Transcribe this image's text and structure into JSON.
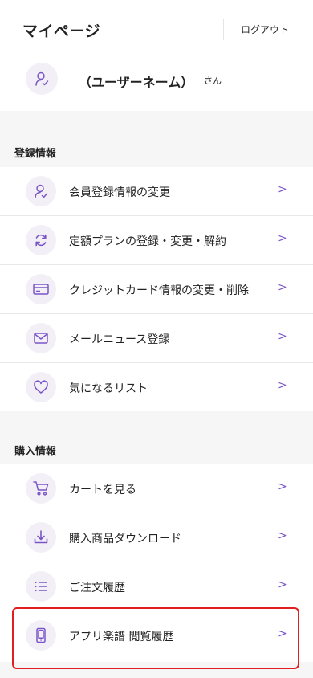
{
  "header": {
    "title": "マイページ",
    "logout_label": "ログアウト"
  },
  "user": {
    "name": "（ユーザーネーム）",
    "suffix": "さん"
  },
  "registration": {
    "title": "登録情報",
    "items": [
      {
        "label": "会員登録情報の変更",
        "icon": "user-icon"
      },
      {
        "label": "定額プランの登録・変更・解約",
        "icon": "refresh-icon"
      },
      {
        "label": "クレジットカード情報の変更・削除",
        "icon": "credit-card-icon"
      },
      {
        "label": "メールニュース登録",
        "icon": "mail-icon"
      },
      {
        "label": "気になるリスト",
        "icon": "heart-icon"
      }
    ]
  },
  "purchase": {
    "title": "購入情報",
    "items": [
      {
        "label": "カートを見る",
        "icon": "cart-icon"
      },
      {
        "label": "購入商品ダウンロード",
        "icon": "download-icon"
      },
      {
        "label": "ご注文履歴",
        "icon": "list-icon"
      },
      {
        "label": "アプリ楽譜 閲覧履歴",
        "icon": "smartphone-icon"
      }
    ]
  },
  "chevron": ">",
  "colors": {
    "accent": "#7a55c8",
    "icon_bg": "#f2f0f6",
    "highlight": "#e02020"
  }
}
